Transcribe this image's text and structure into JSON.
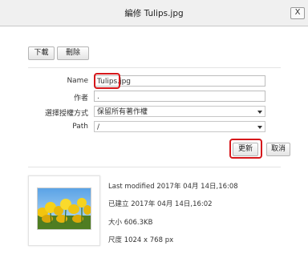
{
  "dialog": {
    "title": "編修 Tulips.jpg",
    "close_label": "X"
  },
  "toolbar": {
    "download_label": "下載",
    "delete_label": "刪除"
  },
  "form": {
    "name_label": "Name",
    "name_value": "Tulips.jpg",
    "author_label": "作者",
    "author_value": ".",
    "license_label": "選擇授權方式",
    "license_value": "保留所有著作權",
    "path_label": "Path",
    "path_value": "/"
  },
  "actions": {
    "update_label": "更新",
    "cancel_label": "取消"
  },
  "file_info": {
    "last_modified": "Last modified 2017年 04月 14日,16:08",
    "created": "已建立 2017年 04月 14日,16:02",
    "size": "大小 606.3KB",
    "dimensions": "尺度 1024 x 768 px"
  },
  "highlight_color": "#d6171b"
}
